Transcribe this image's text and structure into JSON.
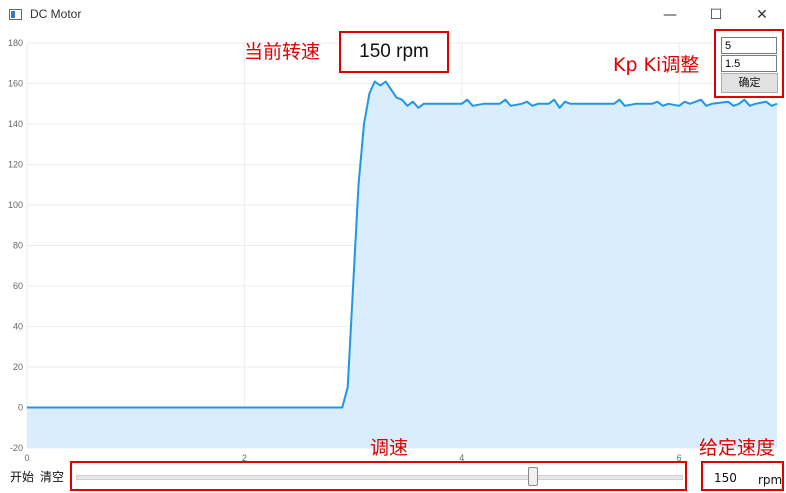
{
  "window": {
    "title": "DC Motor",
    "controls": {
      "minimize": "—",
      "maximize": "☐",
      "close": "✕"
    }
  },
  "annotations": {
    "current_speed_label": "当前转速",
    "pi_tuning_label": "Kp Ki调整",
    "speed_adjust_label": "调速",
    "setpoint_label": "给定速度"
  },
  "current_speed": {
    "value": "150 rpm"
  },
  "pi_panel": {
    "kp": "5",
    "ki": "1.5",
    "confirm_label": "确定"
  },
  "footer": {
    "start_label": "开始",
    "clear_label": "清空",
    "slider_fraction": 0.76,
    "setpoint_value": "150",
    "setpoint_unit": "rpm"
  },
  "colors": {
    "line": "#2196e8",
    "area": "#d9edfc",
    "annotation": "#e00000"
  },
  "chart_data": {
    "type": "area",
    "xlim": [
      0,
      6.9
    ],
    "ylim": [
      -20,
      180
    ],
    "y_ticks": [
      -20,
      0,
      20,
      40,
      60,
      80,
      100,
      120,
      140,
      160,
      180
    ],
    "x_ticks": [
      0,
      2,
      4,
      6
    ],
    "grid": true,
    "series": [
      {
        "points": [
          [
            0,
            0
          ],
          [
            2.8,
            0
          ],
          [
            2.9,
            0
          ],
          [
            2.95,
            10
          ],
          [
            3.0,
            60
          ],
          [
            3.05,
            110
          ],
          [
            3.1,
            140
          ],
          [
            3.15,
            155
          ],
          [
            3.2,
            161
          ],
          [
            3.25,
            159
          ],
          [
            3.3,
            161
          ],
          [
            3.35,
            157
          ],
          [
            3.4,
            153
          ],
          [
            3.45,
            152
          ],
          [
            3.5,
            149
          ],
          [
            3.55,
            151
          ],
          [
            3.6,
            148
          ],
          [
            3.65,
            150
          ],
          [
            3.8,
            150
          ],
          [
            3.85,
            150
          ],
          [
            4.0,
            150
          ],
          [
            4.05,
            152
          ],
          [
            4.1,
            149
          ],
          [
            4.2,
            150
          ],
          [
            4.35,
            150
          ],
          [
            4.4,
            152
          ],
          [
            4.45,
            149
          ],
          [
            4.55,
            150
          ],
          [
            4.6,
            151
          ],
          [
            4.65,
            149
          ],
          [
            4.7,
            150
          ],
          [
            4.8,
            150
          ],
          [
            4.85,
            152
          ],
          [
            4.9,
            148
          ],
          [
            4.95,
            151
          ],
          [
            5.0,
            150
          ],
          [
            5.4,
            150
          ],
          [
            5.45,
            152
          ],
          [
            5.5,
            149
          ],
          [
            5.6,
            150
          ],
          [
            5.75,
            150
          ],
          [
            5.8,
            151
          ],
          [
            5.85,
            149
          ],
          [
            5.9,
            150
          ],
          [
            6.0,
            149
          ],
          [
            6.05,
            151
          ],
          [
            6.1,
            150
          ],
          [
            6.2,
            152
          ],
          [
            6.25,
            149
          ],
          [
            6.3,
            150
          ],
          [
            6.45,
            151
          ],
          [
            6.5,
            149
          ],
          [
            6.55,
            150
          ],
          [
            6.6,
            152
          ],
          [
            6.65,
            149
          ],
          [
            6.7,
            150
          ],
          [
            6.8,
            151
          ],
          [
            6.85,
            149
          ],
          [
            6.9,
            150
          ]
        ]
      }
    ]
  }
}
